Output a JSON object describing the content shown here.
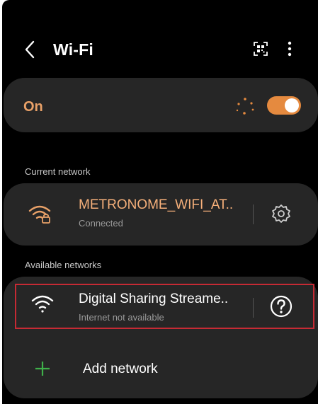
{
  "header": {
    "title": "Wi-Fi"
  },
  "wifi_toggle": {
    "label": "On",
    "enabled": true
  },
  "current_network": {
    "section_label": "Current network",
    "name": "METRONOME_WIFI_AT..",
    "status": "Connected"
  },
  "available_networks": {
    "section_label": "Available networks",
    "items": [
      {
        "name": "Digital Sharing Streame..",
        "status": "Internet not available"
      }
    ],
    "add_label": "Add network"
  },
  "colors": {
    "accent": "#e58a3f",
    "accent_text": "#e9a168",
    "connected_name": "#f6b07a",
    "plus_green": "#3fb04a",
    "highlight_border": "#c62a34"
  }
}
